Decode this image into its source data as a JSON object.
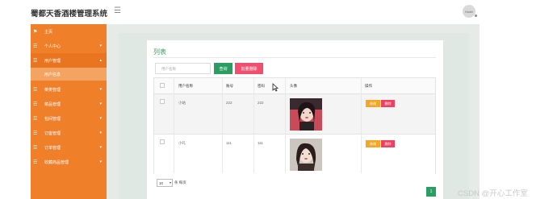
{
  "header": {
    "app_title": "蜀都天香酒楼管理系统",
    "menu_toggle_icon": "hamburger-icon",
    "avatar_text": "Hoah"
  },
  "sidebar": {
    "items": [
      {
        "label": "主页",
        "icon": "flag-icon",
        "has_arrow": false
      },
      {
        "label": "个人中心",
        "icon": "list-icon",
        "has_arrow": true
      },
      {
        "label": "用户管理",
        "icon": "list-icon",
        "has_arrow": true,
        "active": true
      },
      {
        "label": "菜类管理",
        "icon": "list-icon",
        "has_arrow": true
      },
      {
        "label": "菜品管理",
        "icon": "list-icon",
        "has_arrow": true
      },
      {
        "label": "包间管理",
        "icon": "list-icon",
        "has_arrow": true
      },
      {
        "label": "订座管理",
        "icon": "list-icon",
        "has_arrow": true
      },
      {
        "label": "订单管理",
        "icon": "list-icon",
        "has_arrow": true
      },
      {
        "label": "收藏商品管理",
        "icon": "list-icon",
        "has_arrow": true
      }
    ],
    "sub_item": {
      "label": "用户信息"
    }
  },
  "main": {
    "list_title": "列表",
    "search": {
      "placeholder": "用户名称",
      "value": ""
    },
    "search_button": "查询",
    "bulk_delete_button": "批量删除",
    "table": {
      "columns": [
        "用户名称",
        "账号",
        "密码",
        "头像",
        "操作"
      ],
      "rows": [
        {
          "username": "小站",
          "account": "222",
          "password": "222",
          "edit_label": "修改",
          "delete_label": "删除"
        },
        {
          "username": "小礼",
          "account": "111",
          "password": "111",
          "edit_label": "修改",
          "delete_label": "删除"
        }
      ]
    },
    "pagination": {
      "page_size": "10",
      "page_size_suffix": "条 每页",
      "current_page": "1"
    }
  },
  "watermark": "CSDN @开心工作室",
  "colors": {
    "sidebar": "#f07f2a",
    "accent_green": "#2a9d63",
    "danger_pink": "#f0506e",
    "edit_orange": "#f5a623"
  }
}
